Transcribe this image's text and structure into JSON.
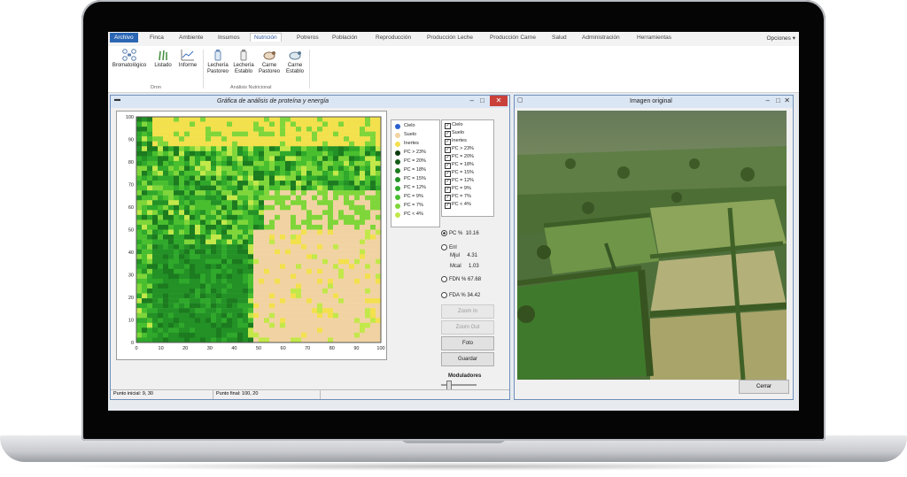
{
  "ribbon": {
    "file_tab": "Archivo",
    "tabs": [
      "Finca",
      "Ambiente",
      "Insumos",
      "Nutrición",
      "Potreros",
      "Población",
      "Reproducción",
      "Producción Leche",
      "Producción Carne",
      "Salud",
      "Administración",
      "Herramientas"
    ],
    "active_tab_index": 3,
    "options": "Opciones",
    "dron_buttons": [
      "Bromatológico",
      "Listado",
      "Informe"
    ],
    "dron_group": "Dron",
    "nutri_buttons": [
      [
        "Lechería",
        "Pastoreo"
      ],
      [
        "Lechería",
        "Establo"
      ],
      [
        "Carne",
        "Pastoreo"
      ],
      [
        "Carne",
        "Establo"
      ]
    ],
    "nutri_group": "Análisis Nutricional"
  },
  "analysis_window": {
    "title": "Gráfica de análisis de proteína y energía",
    "y_ticks": [
      "100",
      "90",
      "80",
      "70",
      "60",
      "50",
      "40",
      "30",
      "20",
      "10",
      "0"
    ],
    "x_ticks": [
      "0",
      "10",
      "20",
      "30",
      "40",
      "50",
      "60",
      "70",
      "80",
      "90",
      "100"
    ],
    "legend": [
      {
        "label": "Cielo",
        "color": "#2a5fd0"
      },
      {
        "label": "Suelo",
        "color": "#f1d3a3"
      },
      {
        "label": "Inertes",
        "color": "#f3e04d"
      },
      {
        "label": "PC > 23%",
        "color": "#0d3b10"
      },
      {
        "label": "PC = 20%",
        "color": "#165c19"
      },
      {
        "label": "PC = 18%",
        "color": "#1c7a1f"
      },
      {
        "label": "PC = 15%",
        "color": "#239126"
      },
      {
        "label": "PC = 12%",
        "color": "#2fa82b"
      },
      {
        "label": "PC = 9%",
        "color": "#49bf2f"
      },
      {
        "label": "PC = 7%",
        "color": "#7fd63a"
      },
      {
        "label": "PC < 4%",
        "color": "#c2e84a"
      }
    ],
    "checklist": [
      "Cielo",
      "Suelo",
      "Inertes",
      "PC > 23%",
      "PC = 20%",
      "PC = 18%",
      "PC = 15%",
      "PC = 12%",
      "PC = 9%",
      "PC = 7%",
      "PC < 4%"
    ],
    "metrics": {
      "pc_label": "PC %",
      "pc_value": "10.16",
      "enl_label": "Enl",
      "mjul_label": "Mjul",
      "mjul_value": "4.31",
      "mcal_label": "Mcal",
      "mcal_value": "1.03",
      "fdn_label": "FDN %",
      "fdn_value": "67.68",
      "fda_label": "FDA %",
      "fda_value": "34.42"
    },
    "buttons": {
      "zoom_in": "Zoom In",
      "zoom_out": "Zoom Out",
      "photo": "Foto",
      "save": "Guardar"
    },
    "modulator_label": "Moduladores",
    "status_start": "Punto inicial: 9, 30",
    "status_end": "Punto final: 100, 20"
  },
  "photo_window": {
    "title": "Imagen original",
    "close_button": "Cerrar"
  },
  "colors": {
    "accent": "#2b66b5",
    "close_red": "#c9413a"
  }
}
